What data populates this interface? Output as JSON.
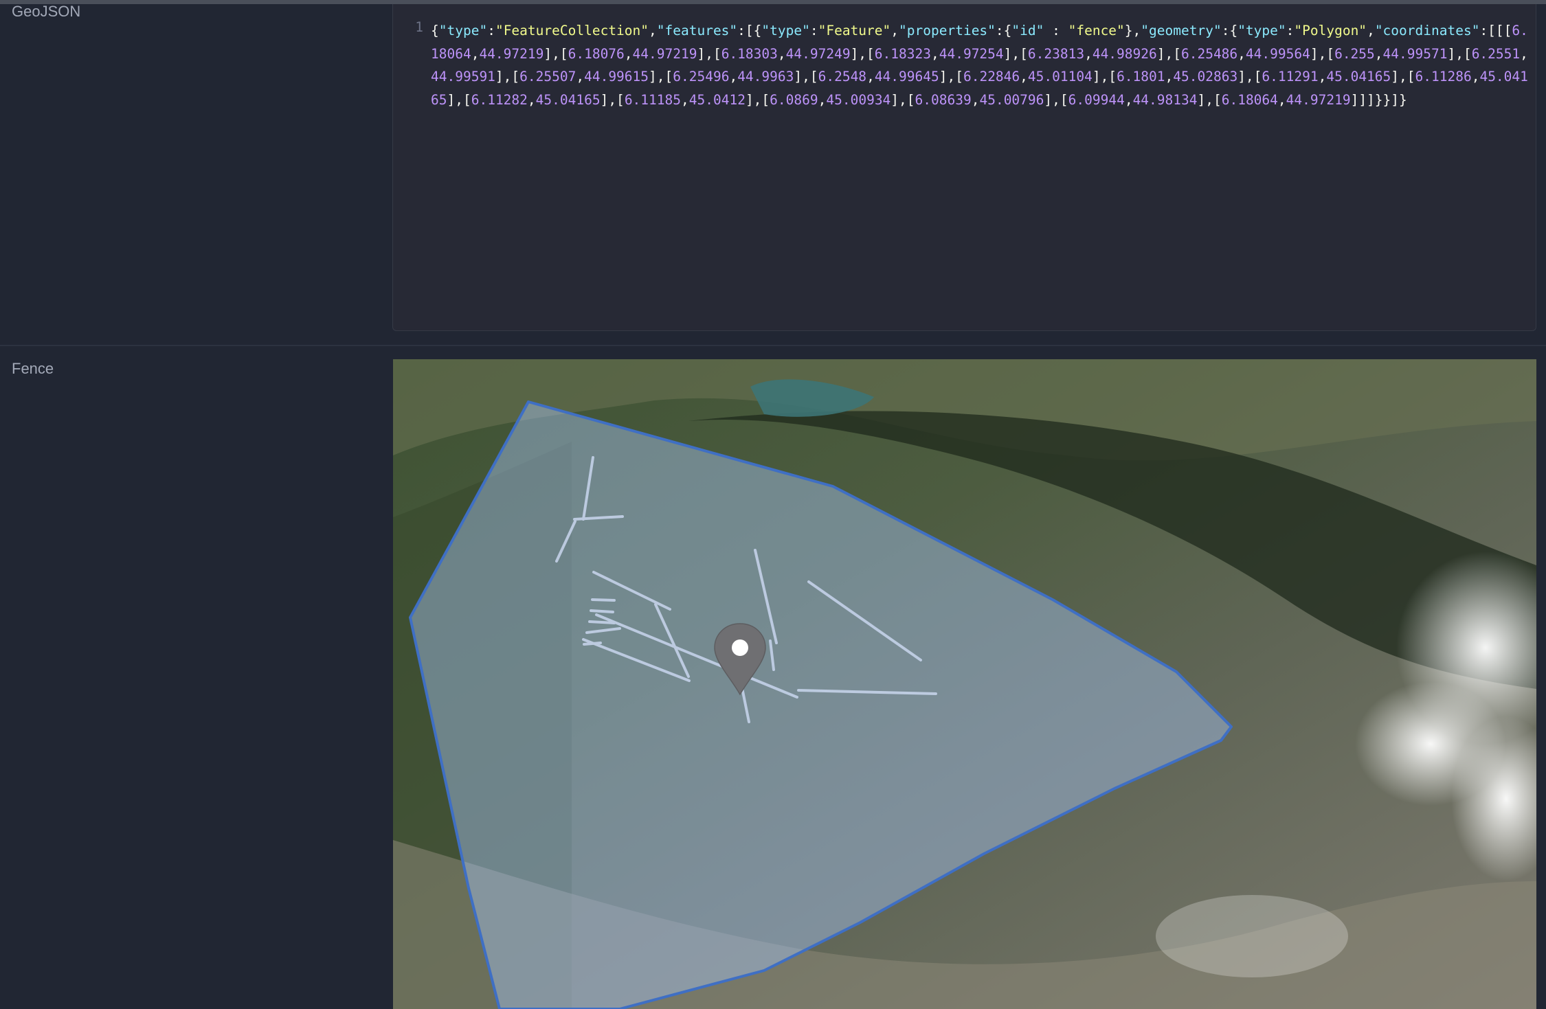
{
  "fields": {
    "geojson_label": "GeoJSON",
    "fence_label": "Fence"
  },
  "editor": {
    "line_number": "1",
    "tokens": [
      {
        "t": "punc",
        "v": "{"
      },
      {
        "t": "key",
        "v": "\"type\""
      },
      {
        "t": "punc",
        "v": ":"
      },
      {
        "t": "str",
        "v": "\"FeatureCollection\""
      },
      {
        "t": "punc",
        "v": ","
      },
      {
        "t": "key",
        "v": "\"features\""
      },
      {
        "t": "punc",
        "v": ":[{"
      },
      {
        "t": "key",
        "v": "\"type\""
      },
      {
        "t": "punc",
        "v": ":"
      },
      {
        "t": "str",
        "v": "\"Feature\""
      },
      {
        "t": "punc",
        "v": ","
      },
      {
        "t": "key",
        "v": "\"properties\""
      },
      {
        "t": "punc",
        "v": ":{"
      },
      {
        "t": "key",
        "v": "\"id\""
      },
      {
        "t": "punc",
        "v": " : "
      },
      {
        "t": "str",
        "v": "\"fence\""
      },
      {
        "t": "punc",
        "v": "},"
      },
      {
        "t": "key",
        "v": "\"geometry\""
      },
      {
        "t": "punc",
        "v": ":"
      },
      {
        "t": "punc",
        "v": "{"
      },
      {
        "t": "key",
        "v": "\"type\""
      },
      {
        "t": "punc",
        "v": ":"
      },
      {
        "t": "str",
        "v": "\"Polygon\""
      },
      {
        "t": "punc",
        "v": ","
      },
      {
        "t": "key",
        "v": "\"coordinates\""
      },
      {
        "t": "punc",
        "v": ":[[["
      },
      {
        "t": "num",
        "v": "6.18064"
      },
      {
        "t": "punc",
        "v": ","
      },
      {
        "t": "num",
        "v": "44.97219"
      },
      {
        "t": "punc",
        "v": "],["
      },
      {
        "t": "num",
        "v": "6.18076"
      },
      {
        "t": "punc",
        "v": ","
      },
      {
        "t": "num",
        "v": "44.97219"
      },
      {
        "t": "punc",
        "v": "],["
      },
      {
        "t": "num",
        "v": "6.18303"
      },
      {
        "t": "punc",
        "v": ","
      },
      {
        "t": "num",
        "v": "44.97249"
      },
      {
        "t": "punc",
        "v": "],["
      },
      {
        "t": "num",
        "v": "6.18323"
      },
      {
        "t": "punc",
        "v": ","
      },
      {
        "t": "num",
        "v": "44.97254"
      },
      {
        "t": "punc",
        "v": "],["
      },
      {
        "t": "num",
        "v": "6.23813"
      },
      {
        "t": "punc",
        "v": ","
      },
      {
        "t": "num",
        "v": "44.98926"
      },
      {
        "t": "punc",
        "v": "],["
      },
      {
        "t": "num",
        "v": "6.25486"
      },
      {
        "t": "punc",
        "v": ","
      },
      {
        "t": "num",
        "v": "44.99564"
      },
      {
        "t": "punc",
        "v": "],["
      },
      {
        "t": "num",
        "v": "6.255"
      },
      {
        "t": "punc",
        "v": ","
      },
      {
        "t": "num",
        "v": "44.99571"
      },
      {
        "t": "punc",
        "v": "],["
      },
      {
        "t": "num",
        "v": "6.2551"
      },
      {
        "t": "punc",
        "v": ","
      },
      {
        "t": "num",
        "v": "44.99591"
      },
      {
        "t": "punc",
        "v": "],["
      },
      {
        "t": "num",
        "v": "6.25507"
      },
      {
        "t": "punc",
        "v": ","
      },
      {
        "t": "num",
        "v": "44.99615"
      },
      {
        "t": "punc",
        "v": "],["
      },
      {
        "t": "num",
        "v": "6.25496"
      },
      {
        "t": "punc",
        "v": ","
      },
      {
        "t": "num",
        "v": "44.9963"
      },
      {
        "t": "punc",
        "v": "],["
      },
      {
        "t": "num",
        "v": "6.2548"
      },
      {
        "t": "punc",
        "v": ","
      },
      {
        "t": "num",
        "v": "44.99645"
      },
      {
        "t": "punc",
        "v": "],["
      },
      {
        "t": "num",
        "v": "6.22846"
      },
      {
        "t": "punc",
        "v": ","
      },
      {
        "t": "num",
        "v": "45.01104"
      },
      {
        "t": "punc",
        "v": "],["
      },
      {
        "t": "num",
        "v": "6.1801"
      },
      {
        "t": "punc",
        "v": ","
      },
      {
        "t": "num",
        "v": "45.02863"
      },
      {
        "t": "punc",
        "v": "],["
      },
      {
        "t": "num",
        "v": "6.11291"
      },
      {
        "t": "punc",
        "v": ","
      },
      {
        "t": "num",
        "v": "45.04165"
      },
      {
        "t": "punc",
        "v": "],["
      },
      {
        "t": "num",
        "v": "6.11286"
      },
      {
        "t": "punc",
        "v": ","
      },
      {
        "t": "num",
        "v": "45.04165"
      },
      {
        "t": "punc",
        "v": "],["
      },
      {
        "t": "num",
        "v": "6.11282"
      },
      {
        "t": "punc",
        "v": ","
      },
      {
        "t": "num",
        "v": "45.04165"
      },
      {
        "t": "punc",
        "v": "],["
      },
      {
        "t": "num",
        "v": "6.11185"
      },
      {
        "t": "punc",
        "v": ","
      },
      {
        "t": "num",
        "v": "45.0412"
      },
      {
        "t": "punc",
        "v": "],["
      },
      {
        "t": "num",
        "v": "6.0869"
      },
      {
        "t": "punc",
        "v": ","
      },
      {
        "t": "num",
        "v": "45.00934"
      },
      {
        "t": "punc",
        "v": "],["
      },
      {
        "t": "num",
        "v": "6.08639"
      },
      {
        "t": "punc",
        "v": ","
      },
      {
        "t": "num",
        "v": "45.00796"
      },
      {
        "t": "punc",
        "v": "],["
      },
      {
        "t": "num",
        "v": "6.09944"
      },
      {
        "t": "punc",
        "v": ","
      },
      {
        "t": "num",
        "v": "44.98134"
      },
      {
        "t": "punc",
        "v": "],["
      },
      {
        "t": "num",
        "v": "6.18064"
      },
      {
        "t": "punc",
        "v": ","
      },
      {
        "t": "num",
        "v": "44.97219"
      },
      {
        "t": "punc",
        "v": "]]]}}]}"
      }
    ]
  },
  "map": {
    "fence_fill_color": "#a7c3f2",
    "fence_stroke_color": "#3f6fc4",
    "marker_color": "#6f6f72",
    "marker_icon": "map-pin-icon",
    "ski_lift_color": "#c9d6ee"
  },
  "colors": {
    "background": "#212633",
    "editor_background": "#272935",
    "label_text": "#a3a9b8",
    "syntax_key": "#8be9fd",
    "syntax_string": "#f1fa8c",
    "syntax_number": "#bd93f9"
  }
}
